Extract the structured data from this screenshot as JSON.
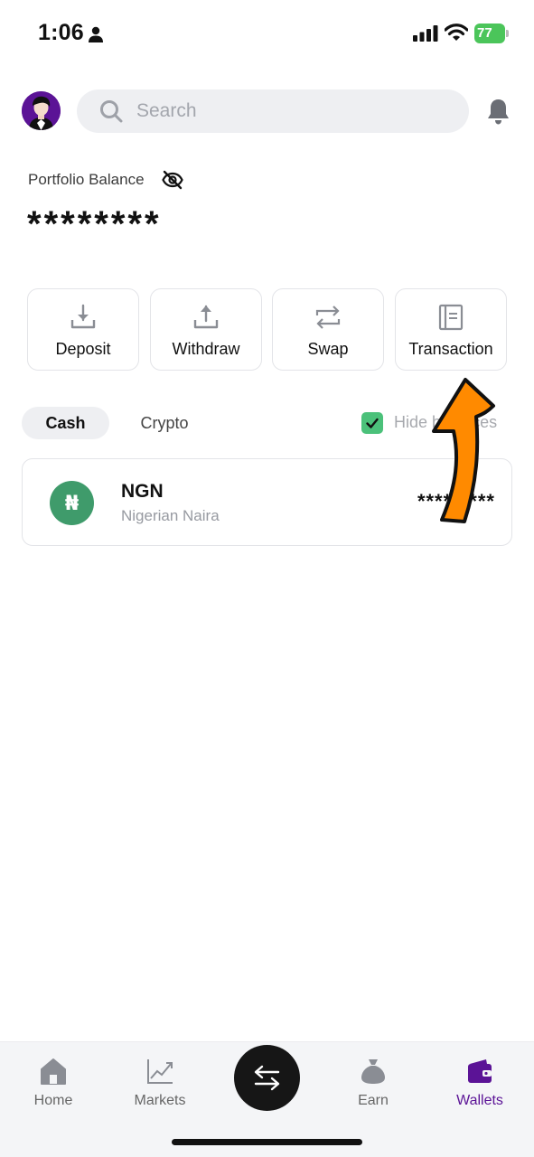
{
  "status_bar": {
    "time": "1:06",
    "battery": "77",
    "icons": [
      "person-icon",
      "signal-icon",
      "wifi-icon",
      "battery-icon"
    ]
  },
  "header": {
    "search_placeholder": "Search",
    "icons": [
      "avatar",
      "search-icon",
      "bell-icon"
    ]
  },
  "portfolio": {
    "label": "Portfolio Balance",
    "balance": "********",
    "visibility_icon": "eye-off-icon"
  },
  "actions": [
    {
      "label": "Deposit",
      "icon": "download-icon"
    },
    {
      "label": "Withdraw",
      "icon": "upload-icon"
    },
    {
      "label": "Swap",
      "icon": "swap-icon"
    },
    {
      "label": "Transaction",
      "icon": "document-icon"
    }
  ],
  "tabs": {
    "cash": "Cash",
    "crypto": "Crypto",
    "active": "Cash"
  },
  "hide_balances": {
    "label": "Hide balances",
    "checked": true
  },
  "assets": [
    {
      "code": "NGN",
      "name": "Nigerian Naira",
      "symbol": "₦",
      "balance": "*********"
    }
  ],
  "bottom_nav": {
    "items": [
      {
        "label": "Home",
        "icon": "home-icon"
      },
      {
        "label": "Markets",
        "icon": "chart-icon"
      },
      {
        "label": "Earn",
        "icon": "money-bag-icon"
      },
      {
        "label": "Wallets",
        "icon": "wallet-icon"
      }
    ],
    "active": "Wallets",
    "center_button_icon": "swap-arrows-icon"
  },
  "colors": {
    "brand_purple": "#5b1396",
    "check_green": "#4bc17a",
    "naira_green": "#3f9b6b",
    "annotation_orange": "#ff8a00"
  }
}
